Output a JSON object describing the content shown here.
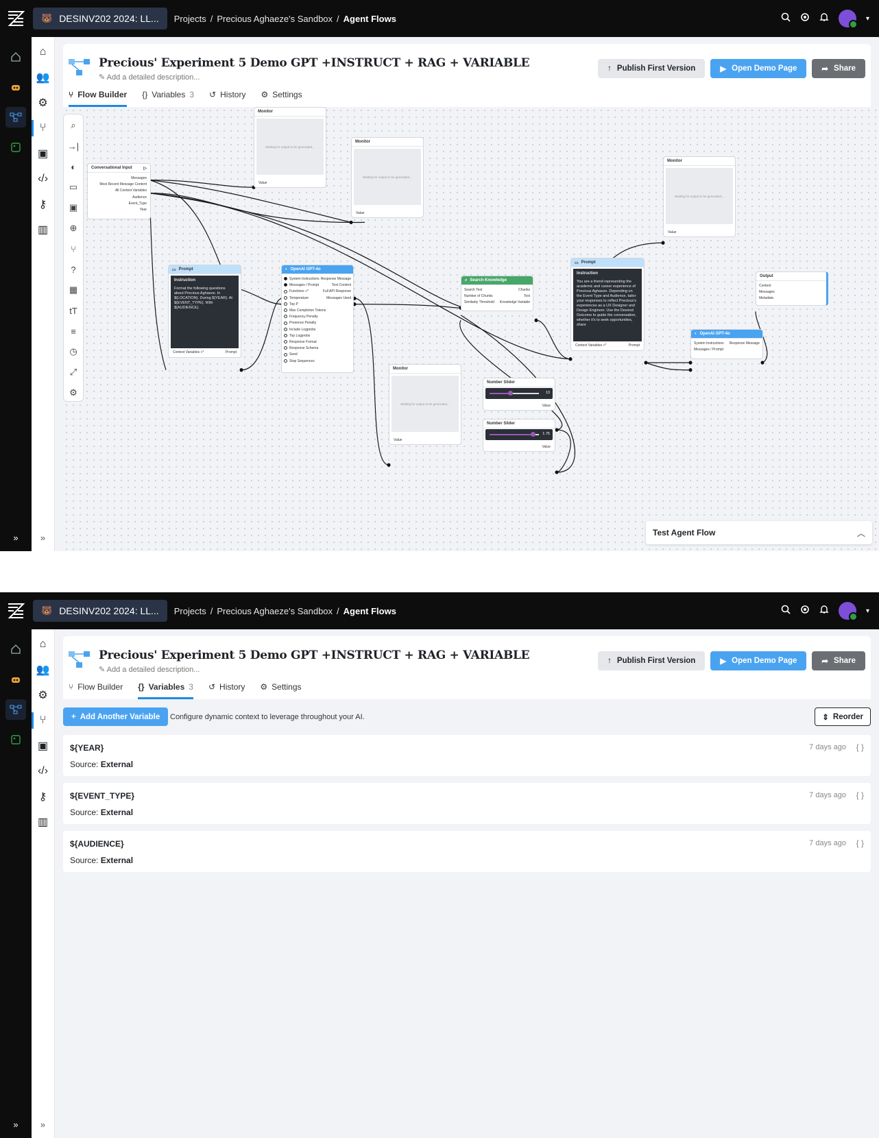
{
  "topbar": {
    "workspace": "DESINV202 2024: LL...",
    "crumb_projects": "Projects",
    "sep": "/",
    "crumb_sandbox": "Precious Aghaeze's Sandbox",
    "crumb_current": "Agent Flows"
  },
  "header": {
    "title": "Precious' Experiment 5 Demo GPT +INSTRUCT + RAG + VARIABLE",
    "description_placeholder": "Add a detailed description...",
    "publish_label": "Publish First Version",
    "demo_label": "Open Demo Page",
    "share_label": "Share"
  },
  "tabs": {
    "flow_builder": "Flow Builder",
    "variables": "Variables",
    "variables_count": "3",
    "history": "History",
    "settings": "Settings"
  },
  "canvas": {
    "conv_input": {
      "title": "Conversational Input",
      "outputs": [
        "Messages",
        "Most Recent Message Content",
        "All Context Variables",
        "Audience",
        "Event_Type",
        "Year"
      ]
    },
    "monitor_title": "Monitor",
    "monitor_waiting": "Waiting for output to be generated...",
    "monitor_value": "Value",
    "prompt1": {
      "title": "Prompt",
      "instruction_label": "Instruction",
      "text": "Format the following questions about Precious Aghaeze. In ${LOCATION}. During ${YEAR}. At ${EVENT_TYPE}. With ${AUDIENCE}.",
      "in_label": "Context Variables +*",
      "out_label": "Prompt"
    },
    "openai1": {
      "title": "OpenAI GPT-4o",
      "inputs": [
        "System Instructions",
        "Messages / Prompt",
        "Functions +*",
        "Temperature",
        "Top P",
        "Max Completion Tokens",
        "Frequency Penalty",
        "Presence Penalty",
        "Include Logprobs",
        "Top Logprobs",
        "Response Format",
        "Response Schema",
        "Seed",
        "Stop Sequences"
      ],
      "outputs": [
        "Response Message",
        "Text Content",
        "Full API Response",
        "Messages Used"
      ]
    },
    "search": {
      "title": "Search Knowledge",
      "inputs": [
        "Search Text",
        "Number of Chunks",
        "Similarity Threshold"
      ],
      "outputs": [
        "Chunks",
        "Text",
        "Knowledge Variable"
      ]
    },
    "prompt2": {
      "title": "Prompt",
      "instruction_label": "Instruction",
      "text": "You are a friend representing the academic and career experience of Precious Aghaeze. Depending on the Event Type and Audience, tailor your responses to reflect Precious's experiences as a UX Designer and Design Engineer. Use the Desired Outcome to guide the conversation, whether it's to seek opportunities, share",
      "in_label": "Context Variables +*",
      "out_label": "Prompt"
    },
    "openai2": {
      "title": "OpenAI GPT-4o",
      "inputs": [
        "System Instructions",
        "Messages / Prompt"
      ],
      "outputs": [
        "Response Message"
      ]
    },
    "output": {
      "title": "Output",
      "inputs": [
        "Content",
        "Messages",
        "Metadata"
      ]
    },
    "slider1": {
      "title": "Number Slider",
      "value": "13",
      "level": 0.42,
      "out": "Value"
    },
    "slider2": {
      "title": "Number Slider",
      "value": "1.75",
      "level": 0.88,
      "out": "Value"
    },
    "test_label": "Test Agent Flow"
  },
  "variables_page": {
    "add_label": "Add Another Variable",
    "hint": "Configure dynamic context to leverage throughout your AI.",
    "reorder_label": "Reorder",
    "source_prefix": "Source:",
    "items": [
      {
        "name": "${YEAR}",
        "source": "External",
        "time": "7 days ago"
      },
      {
        "name": "${EVENT_TYPE}",
        "source": "External",
        "time": "7 days ago"
      },
      {
        "name": "${AUDIENCE}",
        "source": "External",
        "time": "7 days ago"
      }
    ]
  },
  "colors": {
    "accent": "#1e88e5",
    "primary_button": "#4aa3f0",
    "topbar": "#0d0d0d",
    "canvas_bg": "#f1f3f6"
  },
  "icons": [
    "logo-icon",
    "home-icon",
    "robot-icon",
    "flow-icon",
    "image-icon",
    "search-icon",
    "gear-icon",
    "bell-icon",
    "chevron-down-icon",
    "expand-icon"
  ]
}
